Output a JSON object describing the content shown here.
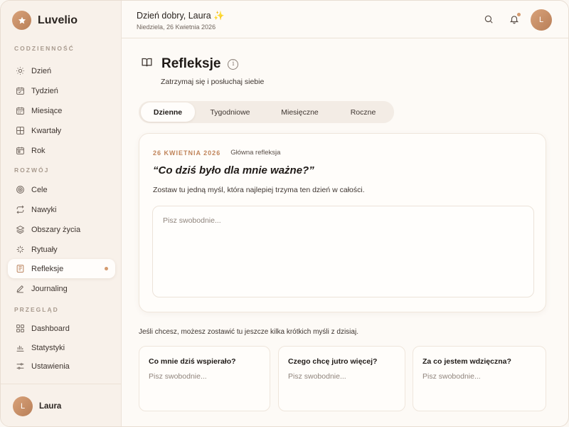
{
  "brand": {
    "name": "Luvelio",
    "icon": "star-icon",
    "accent": "#c48a60"
  },
  "sidebar": {
    "sections": [
      {
        "label": "CODZIENNOŚĆ"
      },
      {
        "label": "ROZWÓJ"
      },
      {
        "label": "PRZEGLĄD"
      }
    ],
    "items": [
      {
        "label": "Dzień",
        "icon": "sun-icon"
      },
      {
        "label": "Tydzień",
        "icon": "calendar-week-icon"
      },
      {
        "label": "Miesiące",
        "icon": "calendar-month-icon"
      },
      {
        "label": "Kwartały",
        "icon": "grid-icon"
      },
      {
        "label": "Rok",
        "icon": "calendar-year-icon"
      },
      {
        "label": "Cele",
        "icon": "target-icon"
      },
      {
        "label": "Nawyki",
        "icon": "repeat-icon"
      },
      {
        "label": "Obszary życia",
        "icon": "layers-icon"
      },
      {
        "label": "Rytuały",
        "icon": "sparkles-icon"
      },
      {
        "label": "Refleksje",
        "icon": "notebook-icon",
        "active": true
      },
      {
        "label": "Journaling",
        "icon": "pen-icon"
      },
      {
        "label": "Dashboard",
        "icon": "dashboard-icon"
      },
      {
        "label": "Statystyki",
        "icon": "bar-chart-icon"
      },
      {
        "label": "Ustawienia",
        "icon": "sliders-icon"
      }
    ],
    "user": {
      "initial": "L",
      "name": "Laura"
    }
  },
  "header": {
    "greeting": "Dzień dobry, Laura ✨",
    "date": "Niedziela, 26 Kwietnia 2026",
    "avatar_initial": "L"
  },
  "page": {
    "title": "Refleksje",
    "info": "i",
    "subtitle": "Zatrzymaj się i posłuchaj siebie"
  },
  "tabs": [
    {
      "label": "Dzienne",
      "active": true
    },
    {
      "label": "Tygodniowe"
    },
    {
      "label": "Miesięczne"
    },
    {
      "label": "Roczne"
    }
  ],
  "reflection": {
    "date": "26 KWIETNIA 2026",
    "kind": "Główna refleksja",
    "question": "“Co dziś było dla mnie ważne?”",
    "description": "Zostaw tu jedną myśl, która najlepiej trzyma ten dzień w całości.",
    "placeholder": "Pisz swobodnie..."
  },
  "extra": {
    "hint": "Jeśli chcesz, możesz zostawić tu jeszcze kilka krótkich myśli z dzisiaj.",
    "cards": [
      {
        "title": "Co mnie dziś wspierało?",
        "placeholder": "Pisz swobodnie..."
      },
      {
        "title": "Czego chcę jutro więcej?",
        "placeholder": "Pisz swobodnie..."
      },
      {
        "title": "Za co jestem wdzięczna?",
        "placeholder": "Pisz swobodnie..."
      }
    ]
  }
}
